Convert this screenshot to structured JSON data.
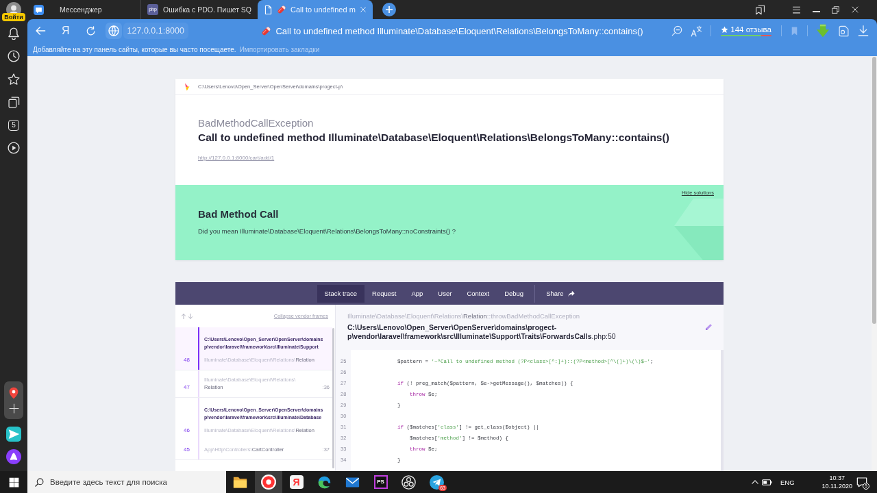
{
  "side_panel": {
    "profile_label": "Войти",
    "counter": "5"
  },
  "tabs": [
    {
      "kind": "messenger",
      "title": "Мессенджер",
      "selected": false
    },
    {
      "kind": "php",
      "icon_text": "php",
      "title": "Ошибка с PDO. Пишет SQ",
      "selected": false
    },
    {
      "kind": "page",
      "title": "Call to undefined m",
      "selected": true
    }
  ],
  "address_bar": {
    "home_button": "Я",
    "url": "127.0.0.1:8000",
    "page_title": "Call to undefined method Illuminate\\Database\\Eloquent\\Relations\\BelongsToMany::contains()",
    "reviews": {
      "label": "144 отзыва",
      "level": 0.79
    }
  },
  "bookmarks_bar": {
    "hint": "Добавляйте на эту панель сайты, которые вы часто посещаете.",
    "link": "Импортировать закладки"
  },
  "error_page": {
    "app_path": "C:\\Users\\Lenovo\\Open_Server\\OpenServer\\domains\\progect-p\\",
    "exception_class": "BadMethodCallException",
    "message": "Call to undefined method Illuminate\\Database\\Eloquent\\Relations\\BelongsToMany::contains()",
    "url": "http://127.0.0.1:8000/cart/add/1",
    "solution": {
      "toggle": "Hide solutions",
      "title": "Bad Method Call",
      "description": "Did you mean Illuminate\\Database\\Eloquent\\Relations\\BelongsToMany::noConstraints() ?"
    },
    "tabs": [
      {
        "label": "Stack trace",
        "selected": true
      },
      {
        "label": "Request",
        "selected": false
      },
      {
        "label": "App",
        "selected": false
      },
      {
        "label": "User",
        "selected": false
      },
      {
        "label": "Context",
        "selected": false
      },
      {
        "label": "Debug",
        "selected": false
      }
    ],
    "share": "Share",
    "collapse_link": "Collapse vendor frames",
    "frame_groups": [
      {
        "file_lines": [
          "C:\\Users\\Lenovo\\Open_Server\\OpenServer\\domains",
          "p\\vendor\\laravel\\framework\\src\\Illuminate\\Support"
        ],
        "frames": [
          {
            "number": "48",
            "namespace": "Illuminate\\Database\\Eloquent\\Relations\\",
            "class": "Relation",
            "selected": true
          }
        ]
      },
      {
        "frames": [
          {
            "number": "47",
            "namespace": "Illuminate\\Database\\Eloquent\\Relations\\",
            "class": "Relation",
            "line": ":36",
            "selected": false
          }
        ]
      },
      {
        "file_lines": [
          "C:\\Users\\Lenovo\\Open_Server\\OpenServer\\domains",
          "p\\vendor\\laravel\\framework\\src\\Illuminate\\Database"
        ],
        "frames": [
          {
            "number": "46",
            "namespace": "Illuminate\\Database\\Eloquent\\Relations\\",
            "class": "Relation",
            "selected": false
          },
          {
            "number": "45",
            "namespace": "App\\Http\\Controllers\\",
            "class": "CartController",
            "line": ":37",
            "selected": false
          }
        ]
      }
    ],
    "selected_frame": {
      "namespace": "Illuminate\\Database\\Eloquent\\Relations\\",
      "class": "Relation",
      "method": "::throwBadMethodCallException",
      "file": "C:\\Users\\Lenovo\\Open_Server\\OpenServer\\domains\\progect-p\\vendor\\laravel\\framework\\src\\Illuminate\\Support\\Traits\\ForwardsCalls",
      "file_suffix": ".php:50"
    },
    "code_lines": [
      {
        "number": "25",
        "tokens": [
          {
            "kind": "plain",
            "text": "        $pattern = "
          },
          {
            "kind": "string",
            "text": "'~^Call to undefined method (?P<class>[^:]+)::(?P<method>[^\\(]+)\\(\\)$~'"
          },
          {
            "kind": "plain",
            "text": ";"
          }
        ]
      },
      {
        "number": "26"
      },
      {
        "number": "27",
        "tokens": [
          {
            "kind": "keyword",
            "text": "        if"
          },
          {
            "kind": "plain",
            "text": " (! preg_match($pattern, $e->getMessage(), $matches)) {"
          }
        ]
      },
      {
        "number": "28",
        "tokens": [
          {
            "kind": "keyword",
            "text": "            throw"
          },
          {
            "kind": "plain",
            "text": " $e;"
          }
        ]
      },
      {
        "number": "29",
        "tokens": [
          {
            "kind": "plain",
            "text": "        }"
          }
        ]
      },
      {
        "number": "30"
      },
      {
        "number": "31",
        "tokens": [
          {
            "kind": "keyword",
            "text": "        if"
          },
          {
            "kind": "plain",
            "text": " ($matches["
          },
          {
            "kind": "string",
            "text": "'class'"
          },
          {
            "kind": "plain",
            "text": "] != get_class($object) ||"
          }
        ]
      },
      {
        "number": "32",
        "tokens": [
          {
            "kind": "plain",
            "text": "            $matches["
          },
          {
            "kind": "string",
            "text": "'method'"
          },
          {
            "kind": "plain",
            "text": "] != $method) {"
          }
        ]
      },
      {
        "number": "33",
        "tokens": [
          {
            "kind": "keyword",
            "text": "            throw"
          },
          {
            "kind": "plain",
            "text": " $e;"
          }
        ]
      },
      {
        "number": "34",
        "tokens": [
          {
            "kind": "plain",
            "text": "        }"
          }
        ]
      }
    ]
  },
  "taskbar": {
    "search": {
      "placeholder": "Введите здесь текст для поиска"
    },
    "apps": [
      {
        "kind": "folder",
        "selected": false
      },
      {
        "kind": "browser",
        "selected": true
      },
      {
        "kind": "tile",
        "icon_text": "Я",
        "selected": false
      },
      {
        "kind": "swirl",
        "selected": false
      },
      {
        "kind": "mail",
        "selected": false
      },
      {
        "kind": "ide",
        "icon_text": "PS",
        "selected": false
      },
      {
        "kind": "recorder",
        "selected": false
      },
      {
        "kind": "plane",
        "badge": "63",
        "selected": false
      }
    ],
    "language": "ENG",
    "time": "10:37",
    "date": "10.11.2020",
    "notifications": "5"
  }
}
